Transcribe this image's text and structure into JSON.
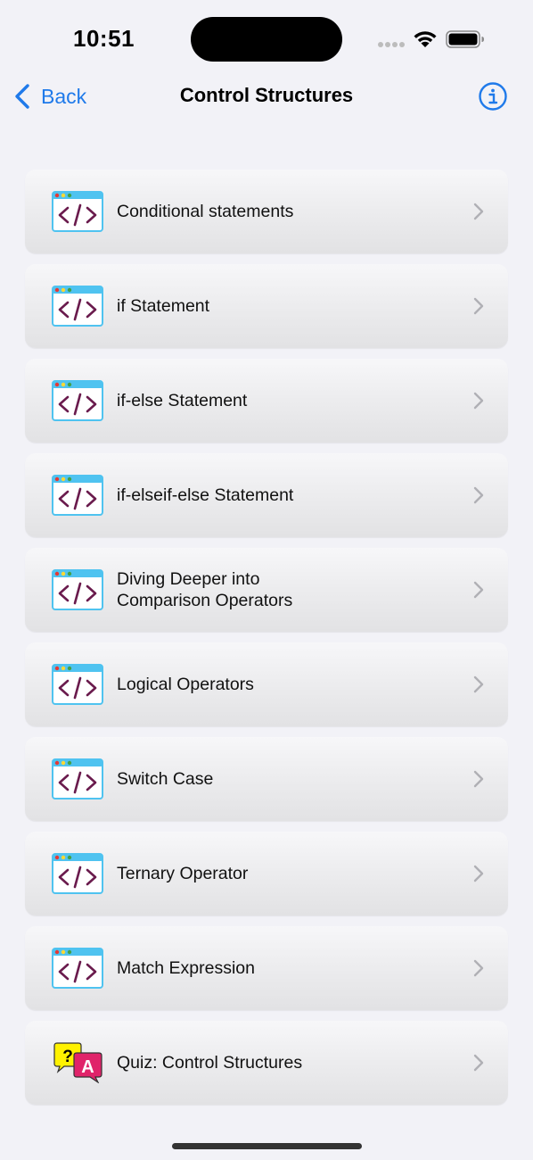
{
  "status_bar": {
    "time": "10:51"
  },
  "nav": {
    "back_label": "Back",
    "title": "Control Structures",
    "info_icon": "info-circle-icon",
    "accent_color": "#1f7aea"
  },
  "items": [
    {
      "label": "Conditional statements",
      "icon": "code-window-icon"
    },
    {
      "label": "if Statement",
      "icon": "code-window-icon"
    },
    {
      "label": "if-else Statement",
      "icon": "code-window-icon"
    },
    {
      "label": "if-elseif-else Statement",
      "icon": "code-window-icon"
    },
    {
      "label": "Diving Deeper into\nComparison Operators",
      "icon": "code-window-icon"
    },
    {
      "label": "Logical Operators",
      "icon": "code-window-icon"
    },
    {
      "label": "Switch Case",
      "icon": "code-window-icon"
    },
    {
      "label": "Ternary Operator",
      "icon": "code-window-icon"
    },
    {
      "label": "Match Expression",
      "icon": "code-window-icon"
    },
    {
      "label": "Quiz: Control Structures",
      "icon": "quiz-bubbles-icon",
      "icon_text": {
        "question": "?",
        "answer": "A"
      }
    }
  ]
}
